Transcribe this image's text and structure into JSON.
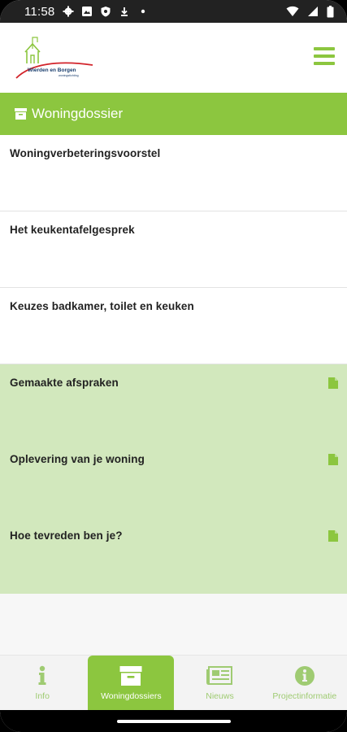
{
  "status_bar": {
    "time": "11:58",
    "icons_left": [
      "gear-icon",
      "photo-icon",
      "shield-icon",
      "download-icon",
      "dot-icon"
    ],
    "icons_right": [
      "wifi-icon",
      "signal-icon",
      "battery-icon"
    ]
  },
  "header": {
    "logo_text": "Wierden en Borgen",
    "logo_subtext": "woningstichting",
    "menu_icon": "hamburger-icon"
  },
  "title_bar": {
    "title": "Woningdossier",
    "icon": "archive-box-icon"
  },
  "list": [
    {
      "label": "Woningverbeteringsvoorstel",
      "style": "white",
      "has_doc_icon": false
    },
    {
      "label": "Het keukentafelgesprek",
      "style": "white",
      "has_doc_icon": false
    },
    {
      "label": "Keuzes badkamer, toilet en keuken",
      "style": "white",
      "has_doc_icon": false
    },
    {
      "label": "Gemaakte afspraken",
      "style": "green",
      "has_doc_icon": true
    },
    {
      "label": "Oplevering van je woning",
      "style": "green",
      "has_doc_icon": true
    },
    {
      "label": "Hoe tevreden ben je?",
      "style": "green",
      "has_doc_icon": true
    }
  ],
  "bottom_nav": [
    {
      "label": "Info",
      "icon": "info-i-icon",
      "active": false
    },
    {
      "label": "Woningdossiers",
      "icon": "archive-box-icon",
      "active": true
    },
    {
      "label": "Nieuws",
      "icon": "newspaper-icon",
      "active": false
    },
    {
      "label": "Projectinformatie",
      "icon": "info-circle-icon",
      "active": false
    }
  ],
  "colors": {
    "brand_green": "#8cc63f",
    "light_green": "#d2e8bd",
    "logo_red": "#d2232a"
  }
}
